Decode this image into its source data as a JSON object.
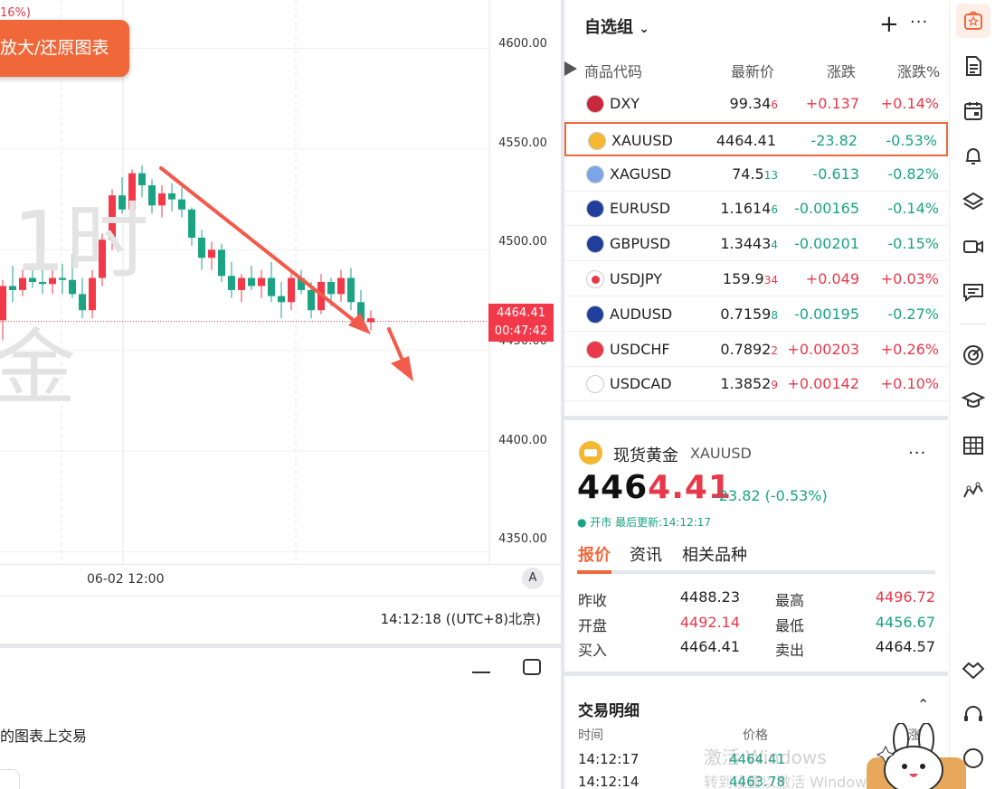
{
  "chart": {
    "corner_text": "16%)",
    "zoom_button": "放大/还原图表",
    "watermark_line1": "1时",
    "watermark_line2": "金",
    "y_labels": [
      "4600.00",
      "4550.00",
      "4500.00",
      "4450.00",
      "4400.00",
      "4350.00"
    ],
    "last_price": "4464.41",
    "countdown": "00:47:42",
    "x_label": "06-02 12:00",
    "axis_mode": "A",
    "colors": {
      "up": "#f2394a",
      "down": "#1ba384",
      "arrow": "#f25a4a"
    }
  },
  "chart_data": {
    "type": "candlestick",
    "candles": [
      [
        4465,
        4485,
        4455,
        4482
      ],
      [
        4482,
        4492,
        4474,
        4480
      ],
      [
        4480,
        4490,
        4477,
        4486
      ],
      [
        4486,
        4492,
        4481,
        4484
      ],
      [
        4484,
        4490,
        4478,
        4483
      ],
      [
        4483,
        4490,
        4478,
        4486
      ],
      [
        4486,
        4493,
        4478,
        4485
      ],
      [
        4485,
        4498,
        4476,
        4478
      ],
      [
        4478,
        4486,
        4466,
        4470
      ],
      [
        4470,
        4490,
        4466,
        4486
      ],
      [
        4486,
        4508,
        4482,
        4505
      ],
      [
        4505,
        4530,
        4500,
        4527
      ],
      [
        4527,
        4536,
        4518,
        4520
      ],
      [
        4520,
        4540,
        4518,
        4538
      ],
      [
        4538,
        4542,
        4526,
        4532
      ],
      [
        4532,
        4535,
        4518,
        4522
      ],
      [
        4522,
        4532,
        4516,
        4528
      ],
      [
        4528,
        4533,
        4519,
        4525
      ],
      [
        4525,
        4531,
        4516,
        4520
      ],
      [
        4520,
        4521,
        4502,
        4506
      ],
      [
        4506,
        4510,
        4490,
        4496
      ],
      [
        4496,
        4504,
        4490,
        4500
      ],
      [
        4500,
        4503,
        4484,
        4487
      ],
      [
        4487,
        4494,
        4476,
        4480
      ],
      [
        4480,
        4488,
        4474,
        4486
      ],
      [
        4486,
        4492,
        4480,
        4482
      ],
      [
        4482,
        4490,
        4476,
        4486
      ],
      [
        4486,
        4494,
        4474,
        4477
      ],
      [
        4477,
        4484,
        4466,
        4474
      ],
      [
        4474,
        4490,
        4470,
        4486
      ],
      [
        4486,
        4490,
        4478,
        4480
      ],
      [
        4480,
        4484,
        4466,
        4470
      ],
      [
        4470,
        4488,
        4468,
        4484
      ],
      [
        4484,
        4486,
        4472,
        4478
      ],
      [
        4478,
        4490,
        4474,
        4486
      ],
      [
        4486,
        4491,
        4470,
        4474
      ],
      [
        4474,
        4480,
        4460,
        4464
      ],
      [
        4464,
        4470,
        4460,
        4466
      ]
    ],
    "ylim": [
      4344,
      4624
    ]
  },
  "time_bar": "14:12:18 ((UTC+8)北京)",
  "bottom_hint": "的图表上交易",
  "watchlist": {
    "title": "自选组",
    "columns": [
      "商品代码",
      "最新价",
      "涨跌",
      "涨跌%"
    ],
    "rows": [
      {
        "symbol": "DXY",
        "price": "99.34",
        "price_tail": "6",
        "change": "+0.137",
        "pct": "+0.14%",
        "dir": "up",
        "flag": "us"
      },
      {
        "symbol": "XAUUSD",
        "price": "4464.41",
        "price_tail": "",
        "change": "-23.82",
        "pct": "-0.53%",
        "dir": "dn",
        "flag": "gold",
        "selected": true
      },
      {
        "symbol": "XAGUSD",
        "price": "74.5",
        "price_tail": "13",
        "change": "-0.613",
        "pct": "-0.82%",
        "dir": "dn",
        "flag": "silver"
      },
      {
        "symbol": "EURUSD",
        "price": "1.1614",
        "price_tail": "6",
        "change": "-0.00165",
        "pct": "-0.14%",
        "dir": "dn",
        "flag": "eu"
      },
      {
        "symbol": "GBPUSD",
        "price": "1.3443",
        "price_tail": "4",
        "change": "-0.00201",
        "pct": "-0.15%",
        "dir": "dn",
        "flag": "gb"
      },
      {
        "symbol": "USDJPY",
        "price": "159.9",
        "price_tail": "34",
        "change": "+0.049",
        "pct": "+0.03%",
        "dir": "up",
        "flag": "jp"
      },
      {
        "symbol": "AUDUSD",
        "price": "0.7159",
        "price_tail": "8",
        "change": "-0.00195",
        "pct": "-0.27%",
        "dir": "dn",
        "flag": "au"
      },
      {
        "symbol": "USDCHF",
        "price": "0.7892",
        "price_tail": "2",
        "change": "+0.00203",
        "pct": "+0.26%",
        "dir": "up",
        "flag": "ch"
      },
      {
        "symbol": "USDCAD",
        "price": "1.3852",
        "price_tail": "9",
        "change": "+0.00142",
        "pct": "+0.10%",
        "dir": "up",
        "flag": "ca"
      }
    ]
  },
  "detail": {
    "name": "现货黄金",
    "symbol": "XAUUSD",
    "price_a": "446",
    "price_b": "4.41",
    "change": "-23.82 (-0.53%)",
    "status": "● 开市 最后更新:14:12:17",
    "tabs": [
      "报价",
      "资讯",
      "相关品种"
    ],
    "stats": [
      {
        "l1": "昨收",
        "v1": "4488.23",
        "c1": "#222",
        "l2": "最高",
        "v2": "4496.72",
        "c2": "#e8394b"
      },
      {
        "l1": "开盘",
        "v1": "4492.14",
        "c1": "#e8394b",
        "l2": "最低",
        "v2": "4456.67",
        "c2": "#1ba384"
      },
      {
        "l1": "买入",
        "v1": "4464.41",
        "c1": "#222",
        "l2": "卖出",
        "v2": "4464.57",
        "c2": "#222"
      }
    ],
    "trades_title": "交易明细",
    "trade_cols": [
      "时间",
      "价格",
      "涨幅"
    ],
    "trades": [
      {
        "time": "14:12:17",
        "price": "4464.41"
      },
      {
        "time": "14:12:14",
        "price": "4463.78"
      }
    ]
  },
  "os_watermark": {
    "line1": "激活 Windows",
    "line2": "转到设置以激活 Windows"
  }
}
